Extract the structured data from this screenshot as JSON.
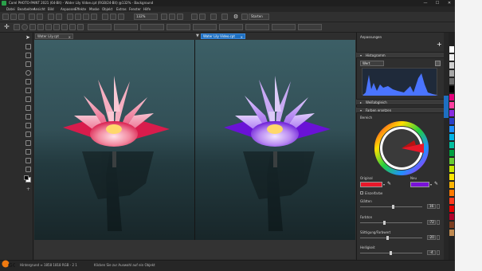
{
  "window": {
    "title": "Corel PHOTO-PAINT 2021 (64-Bit) - Water Lily Vidoe.cpt (RGB/24-Bit) @132% - Background",
    "minimize": "—",
    "maximize": "☐",
    "close": "✕"
  },
  "menu": [
    "Datei",
    "Bearbeiten",
    "Ansicht",
    "Bild",
    "Anpassen",
    "Effekte",
    "Maske",
    "Objekt",
    "Extras",
    "Fenster",
    "Hilfe"
  ],
  "propbar": {
    "zoom": "132%",
    "start_label": "Starten"
  },
  "tabs": [
    {
      "label": "Water Lily.cpt",
      "close": "×",
      "active": false
    },
    {
      "label": "Water Lily Video.cpt",
      "close": "×",
      "active": true
    }
  ],
  "docker": {
    "title": "Anpassungen",
    "add": "+",
    "channel": "Wert",
    "sections": {
      "histogram": "Histogramm",
      "white_balance": "Weißabgleich",
      "replace_colors": "Farben ersetzen"
    },
    "range_label": "Bereich",
    "original_label": "Original",
    "new_label": "Neu",
    "original_color": "#e8182a",
    "new_color": "#7a12d8",
    "single_color_label": "Einzelfarbe",
    "sliders": [
      {
        "label": "Glätten",
        "value": "16",
        "fraction": 0.52
      },
      {
        "label": "Farbton",
        "value": "-72",
        "fraction": 0.38
      },
      {
        "label": "Sättigung/Farbwert",
        "value": "-20",
        "fraction": 0.44
      },
      {
        "label": "Helligkeit",
        "value": "-4",
        "fraction": 0.49
      }
    ]
  },
  "status": {
    "left": "Hintergrund ≡ 1858 1818 RGB - 2 1",
    "hint": "Klicken Sie zur Auswahl auf ein Objekt"
  },
  "logo_text": "GO",
  "palette": [
    "#ffffff",
    "#f0f0f0",
    "#d0d0d0",
    "#a8a8a8",
    "#6e6e6e",
    "#000000",
    "#e4007c",
    "#ff3fa0",
    "#8a2be2",
    "#2b3ec8",
    "#1e8fff",
    "#00b4e6",
    "#00c0a0",
    "#00a040",
    "#66cc33",
    "#c8e600",
    "#ffe600",
    "#ffb400",
    "#ff7a00",
    "#ff3b1e",
    "#e60000",
    "#b0002a",
    "#7a3b1e",
    "#c08a50"
  ]
}
